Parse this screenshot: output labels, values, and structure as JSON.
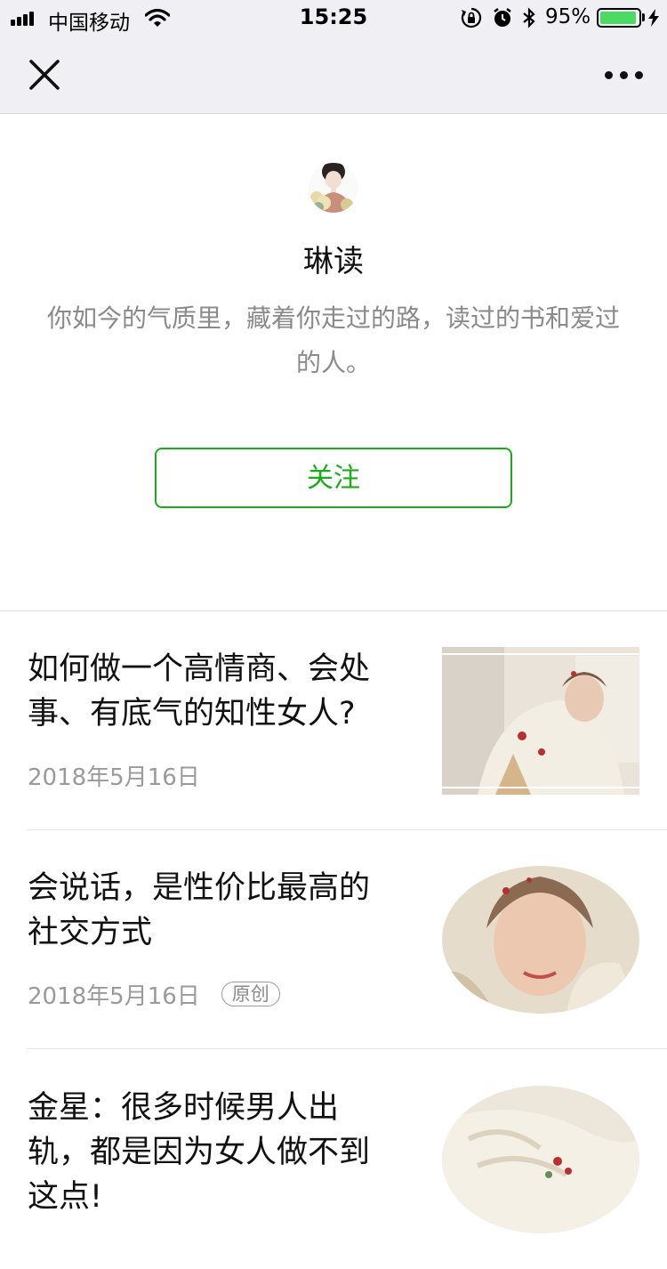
{
  "status_bar": {
    "carrier": "中国移动",
    "time": "15:25",
    "battery_percent": "95%",
    "battery_level": 0.95,
    "icons": [
      "signal-icon",
      "wifi-icon",
      "orientation-lock-icon",
      "alarm-icon",
      "bluetooth-icon",
      "battery-icon",
      "charging-icon"
    ]
  },
  "nav": {
    "close_icon": "close-icon",
    "more_icon": "more-icon"
  },
  "profile": {
    "name": "琳读",
    "bio": "你如今的气质里，藏着你走过的路，读过的书和爱过的人。",
    "follow_label": "关注"
  },
  "articles": [
    {
      "title": "如何做一个高情商、会处事、有底气的知性女人?",
      "date": "2018年5月16日",
      "tag": ""
    },
    {
      "title": "会说话，是性价比最高的社交方式",
      "date": "2018年5月16日",
      "tag": "原创"
    },
    {
      "title": "金星：很多时候男人出轨，都是因为女人做不到这点!",
      "date": "",
      "tag": ""
    }
  ],
  "colors": {
    "accent_green": "#1aad19",
    "bar_background": "#efeff4",
    "battery_green": "#4cd964",
    "muted_text": "#8a8a8a"
  }
}
